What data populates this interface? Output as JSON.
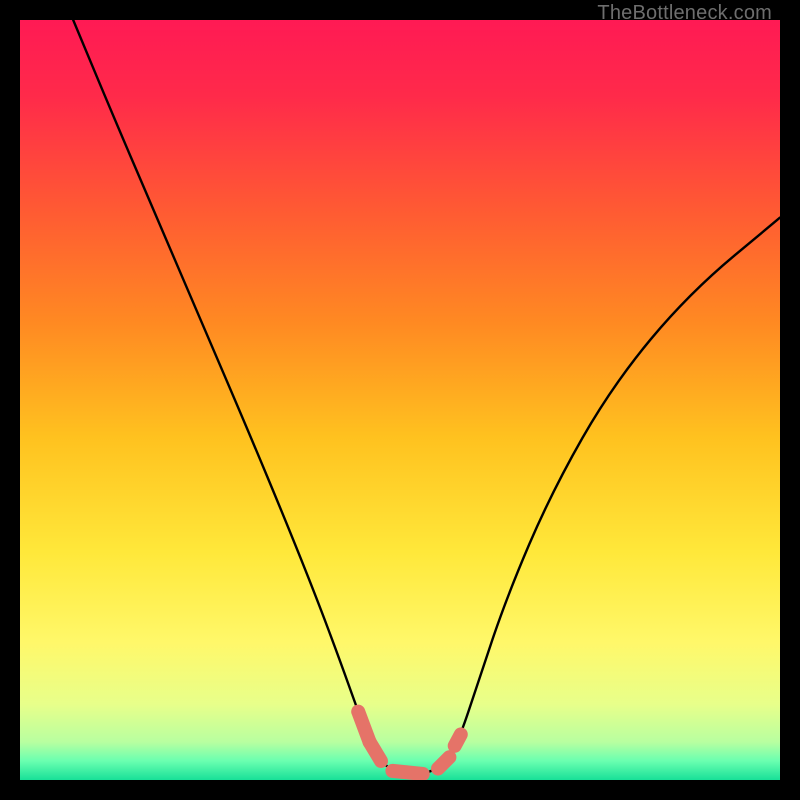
{
  "watermark": "TheBottleneck.com",
  "chart_data": {
    "type": "line",
    "title": "",
    "xlabel": "",
    "ylabel": "",
    "xlim": [
      0,
      100
    ],
    "ylim": [
      0,
      100
    ],
    "grid": false,
    "legend": false,
    "gradient_stops": [
      {
        "offset": 0.0,
        "color": "#ff1a54"
      },
      {
        "offset": 0.1,
        "color": "#ff2a4a"
      },
      {
        "offset": 0.25,
        "color": "#ff5a33"
      },
      {
        "offset": 0.4,
        "color": "#ff8a22"
      },
      {
        "offset": 0.55,
        "color": "#ffc21f"
      },
      {
        "offset": 0.7,
        "color": "#ffe83a"
      },
      {
        "offset": 0.82,
        "color": "#fff86a"
      },
      {
        "offset": 0.9,
        "color": "#e8ff8a"
      },
      {
        "offset": 0.95,
        "color": "#b8ffa0"
      },
      {
        "offset": 0.975,
        "color": "#6affb0"
      },
      {
        "offset": 1.0,
        "color": "#18e098"
      }
    ],
    "series": [
      {
        "name": "bottleneck-curve",
        "color": "#000000",
        "x": [
          7,
          12,
          18,
          24,
          30,
          35,
          39,
          42,
          44.5,
          46,
          47.5,
          49,
          51,
          53,
          55,
          56.5,
          58,
          60,
          64,
          70,
          78,
          88,
          100
        ],
        "y": [
          100,
          88,
          74,
          60,
          46,
          34,
          24,
          16,
          9,
          5,
          2.5,
          1.2,
          0.8,
          0.8,
          1.5,
          3,
          6,
          12,
          24,
          38,
          52,
          64,
          74
        ]
      }
    ],
    "salmon_segments": [
      {
        "x0": 44.5,
        "y0": 9,
        "x1": 46,
        "y1": 5
      },
      {
        "x0": 46,
        "y0": 5,
        "x1": 47.5,
        "y1": 2.5
      },
      {
        "x0": 49,
        "y0": 1.2,
        "x1": 53,
        "y1": 0.8
      },
      {
        "x0": 55,
        "y0": 1.5,
        "x1": 56.5,
        "y1": 3
      },
      {
        "x0": 57.2,
        "y0": 4.5,
        "x1": 58,
        "y1": 6
      }
    ]
  }
}
